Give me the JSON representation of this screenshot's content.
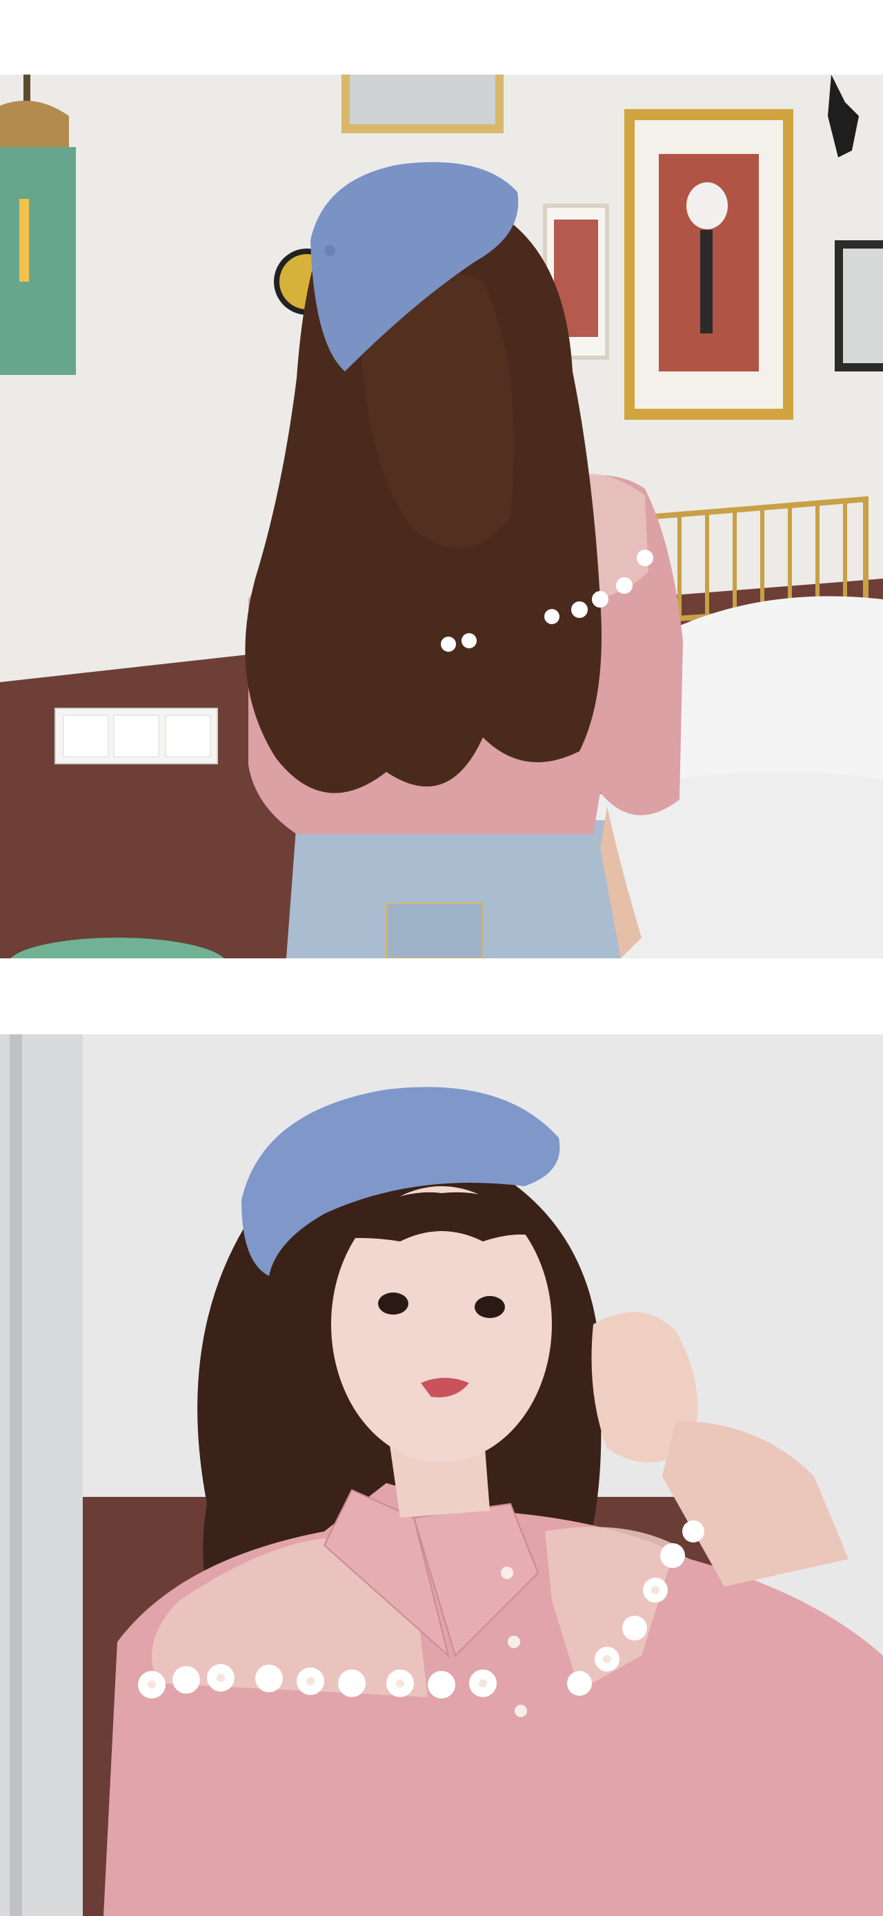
{
  "photos": [
    {
      "subject": "woman-back-view",
      "colors": {
        "wall": "#ecebe8",
        "wainscot": "#6e3f37",
        "beret": "#7a92c4",
        "blouse": "#dca1a5",
        "hair": "#4a2a1c",
        "denim": "#a9bcd0",
        "bedding": "#f1f1f1",
        "frame_gold": "#c9a046",
        "lamp_green": "#4f9a7b"
      }
    },
    {
      "subject": "woman-front-portrait",
      "colors": {
        "wall": "#e8e8e9",
        "wainscot": "#6a3d36",
        "beret": "#7f98c9",
        "blouse": "#e0a4aa",
        "skin": "#f1d7cf",
        "hair": "#3a2219",
        "lace_flowers": "#ffffff"
      }
    }
  ]
}
